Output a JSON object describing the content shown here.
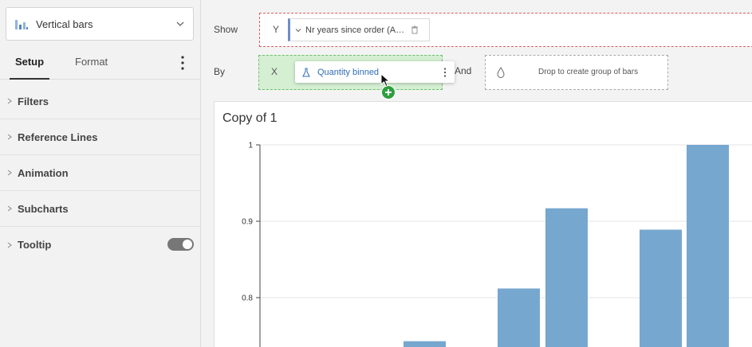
{
  "sidebar": {
    "chart_type": {
      "label": "Vertical bars",
      "icon": "vertical-bars-icon"
    },
    "tabs": [
      {
        "label": "Setup",
        "active": true
      },
      {
        "label": "Format",
        "active": false
      }
    ],
    "sections": [
      {
        "label": "Filters"
      },
      {
        "label": "Reference Lines"
      },
      {
        "label": "Animation"
      },
      {
        "label": "Subcharts"
      },
      {
        "label": "Tooltip",
        "toggle_on": true
      }
    ]
  },
  "shelves": {
    "show": {
      "label": "Show",
      "axis": "Y",
      "pill": "Nr years since order (A…"
    },
    "by": {
      "label": "By",
      "axis": "X",
      "pill": "Quantity binned"
    },
    "and": {
      "label": "And",
      "drop_text": "Drop to create group of bars"
    }
  },
  "colors": {
    "bar": "#76a7cf",
    "accent_green": "#2e9e3e",
    "y_zone_border": "#e05a5a"
  },
  "chart": {
    "title": "Copy of 1"
  },
  "chart_data": {
    "type": "bar",
    "title": "Copy of 1",
    "ylim": [
      0.74,
      1.0
    ],
    "yticks": [
      "1",
      "0.9",
      "0.8"
    ],
    "ytick_values": [
      1.0,
      0.9,
      0.8
    ],
    "grid": true,
    "values": [
      0.705,
      0.743,
      0.812,
      0.917,
      0.889,
      1.0
    ]
  }
}
